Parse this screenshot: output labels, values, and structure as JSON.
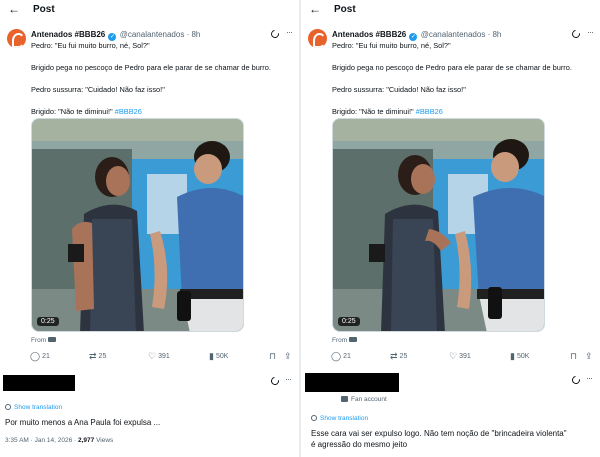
{
  "left": {
    "header": {
      "back_icon": "arrow-left-icon",
      "title": "Post"
    },
    "tweet": {
      "author_name": "Antenados #BBB26",
      "handle": "@canalantenados",
      "time": "· 8h",
      "lines": [
        "Pedro: \"Eu fui muito burro, né, Sol?\"",
        "",
        "Brigido pega no pescoço de Pedro para ele parar de se chamar de burro.",
        "",
        "Pedro sussurra: \"Cuidado! Não faz isso!\"",
        "",
        "Brigido: \"Não te diminui!\""
      ],
      "hashtag": "#BBB26",
      "video_duration": "0:25",
      "from_label": "From"
    },
    "actions": {
      "replies": "21",
      "reposts": "25",
      "likes": "391",
      "views": "50K"
    },
    "reply": {
      "show_translation": "Show translation",
      "text": "Por muito menos a Ana Paula foi expulsa ...",
      "meta_time": "3:35 AM · Jan 14, 2026 · ",
      "meta_views_count": "2,977",
      "meta_views_label": " Views"
    }
  },
  "right": {
    "header": {
      "back_icon": "arrow-left-icon",
      "title": "Post"
    },
    "tweet": {
      "author_name": "Antenados #BBB26",
      "handle": "@canalantenados",
      "time": "· 8h",
      "lines": [
        "Pedro: \"Eu fui muito burro, né, Sol?\"",
        "",
        "Brigido pega no pescoço de Pedro para ele parar de se chamar de burro.",
        "",
        "Pedro sussurra: \"Cuidado! Não faz isso!\"",
        "",
        "Brigido: \"Não te diminui!\""
      ],
      "hashtag": "#BBB26",
      "video_duration": "0:25",
      "from_label": "From"
    },
    "actions": {
      "replies": "21",
      "reposts": "25",
      "likes": "391",
      "views": "50K"
    },
    "reply": {
      "fan_account": "Fan account",
      "show_translation": "Show translation",
      "text_line1": "Esse cara vai ser expulso logo. Não tem noção de \"brincadeira violenta\"",
      "text_line2": "é agressão do mesmo jeito"
    }
  },
  "colors": {
    "accent": "#1d9bf0",
    "muted": "#536471",
    "text": "#0f1419",
    "avatar": "#e8622c"
  }
}
